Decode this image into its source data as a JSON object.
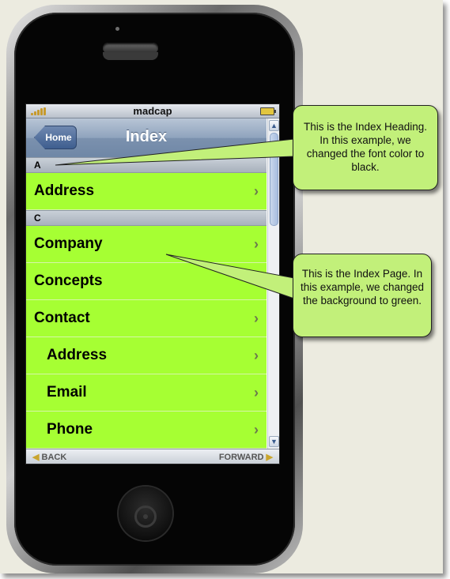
{
  "status_bar": {
    "title": "madcap"
  },
  "nav_bar": {
    "back_button": "Home",
    "title": "Index"
  },
  "index": {
    "sections": [
      {
        "heading": "A",
        "entries": [
          {
            "label": "Address",
            "has_chevron": true
          }
        ]
      },
      {
        "heading": "C",
        "entries": [
          {
            "label": "Company",
            "has_chevron": true
          },
          {
            "label": "Concepts",
            "has_chevron": false
          },
          {
            "label": "Contact",
            "has_chevron": true
          },
          {
            "label": "Address",
            "has_chevron": true,
            "indent": 1
          },
          {
            "label": "Email",
            "has_chevron": true,
            "indent": 1
          },
          {
            "label": "Phone",
            "has_chevron": true,
            "indent": 1
          }
        ]
      }
    ]
  },
  "toolbar": {
    "back_label": "BACK",
    "forward_label": "FORWARD"
  },
  "callouts": {
    "heading_note": "This is the Index Heading. In this example, we changed the font color to black.",
    "page_note": "This is the Index Page. In this example, we changed the background to green."
  },
  "colors": {
    "page_background": "#a6ff33",
    "callout_fill": "#c2f07a",
    "nav_bar": "#7b91ae",
    "frame": "#ecebe0"
  },
  "icons": {
    "row_chevron": "chevron-right-icon",
    "back": "triangle-left-icon",
    "forward": "triangle-right-icon"
  }
}
